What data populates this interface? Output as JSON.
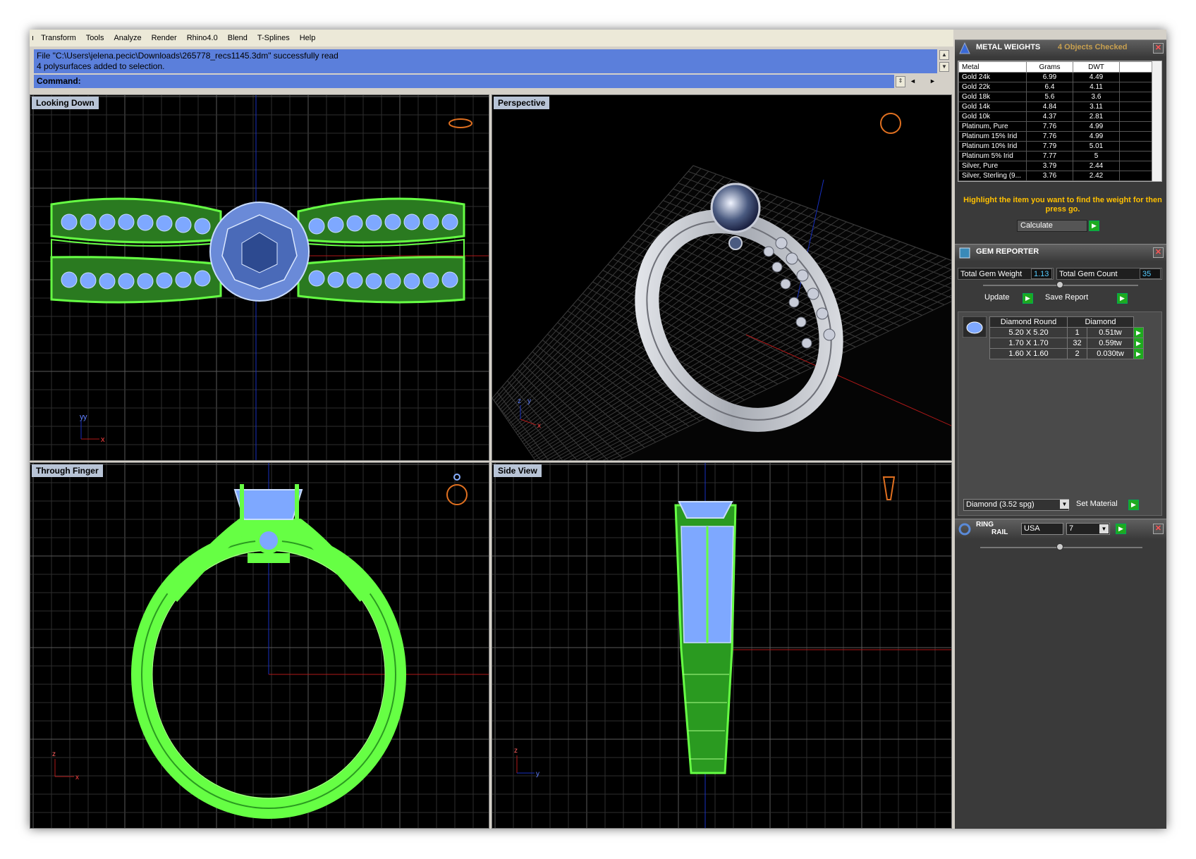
{
  "menu": [
    "Transform",
    "Tools",
    "Analyze",
    "Render",
    "Rhino4.0",
    "Blend",
    "T-Splines",
    "Help"
  ],
  "command": {
    "history_line1": "File \"C:\\Users\\jelena.pecic\\Downloads\\265778_recs1145.3dm\" successfully read",
    "history_line2": "4 polysurfaces added to selection.",
    "prompt": "Command:"
  },
  "viewports": {
    "top_left": "Looking Down",
    "top_right": "Perspective",
    "bottom_left": "Through Finger",
    "bottom_right": "Side View"
  },
  "axes": {
    "x": "x",
    "y": "y",
    "z": "z"
  },
  "colors": {
    "wire_green": "#66ff44",
    "wire_blue": "#7ea8ff",
    "x_axis": "#b01818",
    "y_axis": "#1830c0",
    "accent_orange": "#ffc000"
  },
  "metal_weights": {
    "title": "METAL WEIGHTS",
    "status": "4 Objects Checked",
    "columns": [
      "Metal",
      "Grams",
      "DWT"
    ],
    "rows": [
      [
        "Gold 24k",
        "6.99",
        "4.49"
      ],
      [
        "Gold 22k",
        "6.4",
        "4.11"
      ],
      [
        "Gold 18k",
        "5.6",
        "3.6"
      ],
      [
        "Gold 14k",
        "4.84",
        "3.11"
      ],
      [
        "Gold 10k",
        "4.37",
        "2.81"
      ],
      [
        "Platinum, Pure",
        "7.76",
        "4.99"
      ],
      [
        "Platinum 15% Irid",
        "7.76",
        "4.99"
      ],
      [
        "Platinum 10% Irid",
        "7.79",
        "5.01"
      ],
      [
        "Platinum 5% Irid",
        "7.77",
        "5"
      ],
      [
        "Silver, Pure",
        "3.79",
        "2.44"
      ],
      [
        "Silver, Sterling (9...",
        "3.76",
        "2.42"
      ]
    ],
    "instruction": "Highlight the item you want to find the weight for then press go.",
    "calculate": "Calculate"
  },
  "gem_reporter": {
    "title": "GEM REPORTER",
    "total_weight_label": "Total Gem Weight",
    "total_weight": "1.13",
    "total_count_label": "Total Gem Count",
    "total_count": "35",
    "update": "Update",
    "save_report": "Save Report",
    "columns": [
      "Diamond Round",
      "Diamond"
    ],
    "rows": [
      [
        "5.20 X 5.20",
        "1",
        "0.51tw"
      ],
      [
        "1.70 X 1.70",
        "32",
        "0.59tw"
      ],
      [
        "1.60 X 1.60",
        "2",
        "0.030tw"
      ]
    ],
    "material": "Diamond    (3.52 spg)",
    "set_material": "Set Material"
  },
  "ring_rail": {
    "title_line1": "RING",
    "title_line2": "RAIL",
    "region": "USA",
    "size": "7"
  }
}
